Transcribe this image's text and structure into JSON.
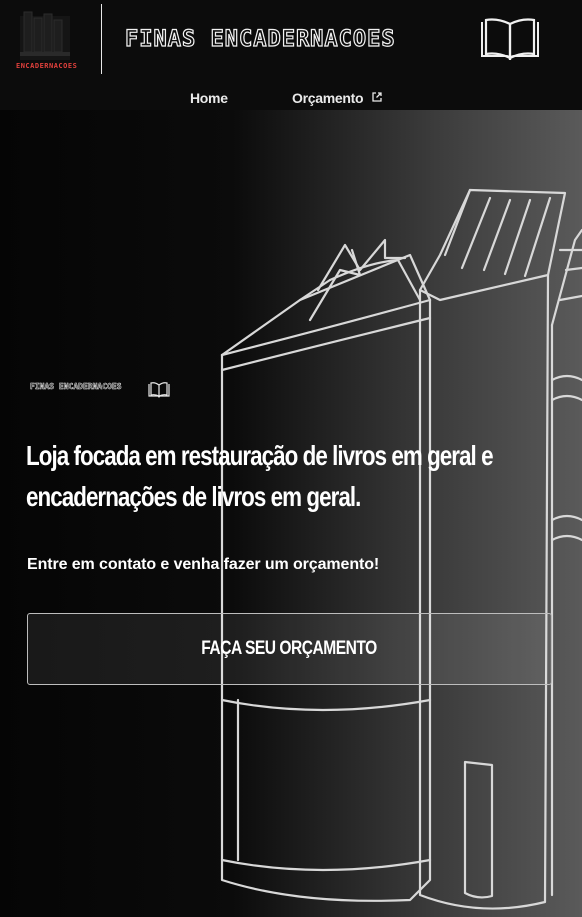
{
  "header": {
    "logo_text": "ENCADERNACOES",
    "brand_title": "FINAS ENCADERNACOES",
    "logo_icon": "book-icon"
  },
  "nav": {
    "items": [
      {
        "label": "Home",
        "external": false
      },
      {
        "label": "Orçamento",
        "external": true,
        "icon": "external-link-icon"
      }
    ]
  },
  "hero": {
    "mini_brand": "FINAS ENCADERNACOES",
    "headline_line1": "Loja focada em restauração de livros em geral e",
    "headline_line2": "encadernações de livros em geral.",
    "subtitle": "Entre em contato e venha fazer um orçamento!",
    "cta_label": "FAÇA SEU ORÇAMENTO",
    "background_icon": "books-illustration"
  },
  "colors": {
    "background": "#0b0b0b",
    "text": "#ffffff",
    "logo_accent": "#e0403c",
    "cta_border": "#bdbdbd"
  }
}
